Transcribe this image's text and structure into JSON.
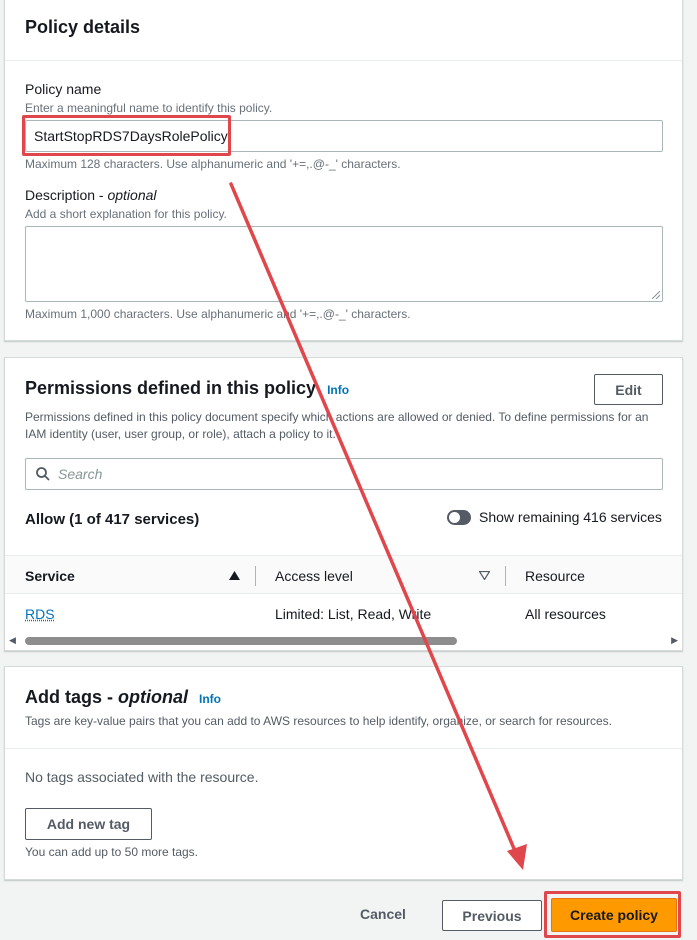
{
  "policy_details": {
    "title": "Policy details",
    "name_label": "Policy name",
    "name_hint": "Enter a meaningful name to identify this policy.",
    "name_value": "StartStopRDS7DaysRolePolicy",
    "name_constraint": "Maximum 128 characters. Use alphanumeric and '+=,.@-_' characters.",
    "desc_label": "Description - ",
    "desc_optional": "optional",
    "desc_hint": "Add a short explanation for this policy.",
    "desc_constraint": "Maximum 1,000 characters. Use alphanumeric and '+=,.@-_' characters."
  },
  "permissions": {
    "title": "Permissions defined in this policy",
    "info": "Info",
    "edit": "Edit",
    "description_line1": "Permissions defined in this policy document specify which actions are allowed or denied. To define permissions for an",
    "description_line2": "IAM identity (user, user group, or role), attach a policy to it.",
    "search_placeholder": "Search",
    "allow_summary": "Allow (1 of 417 services)",
    "toggle_label": "Show remaining 416 services",
    "columns": [
      "Service",
      "Access level",
      "Resource"
    ],
    "rows": [
      {
        "service": "RDS",
        "access_level": "Limited: List, Read, Write",
        "resource": "All resources"
      }
    ]
  },
  "tags": {
    "title": "Add tags - ",
    "optional": "optional",
    "info": "Info",
    "description": "Tags are key-value pairs that you can add to AWS resources to help identify, organize, or search for resources.",
    "empty_text": "No tags associated with the resource.",
    "add_button": "Add new tag",
    "limit_text": "You can add up to 50 more tags."
  },
  "footer": {
    "cancel": "Cancel",
    "previous": "Previous",
    "create": "Create policy"
  },
  "colors": {
    "primary": "#ff9900",
    "link": "#0073bb",
    "annotation": "#e0474c"
  }
}
